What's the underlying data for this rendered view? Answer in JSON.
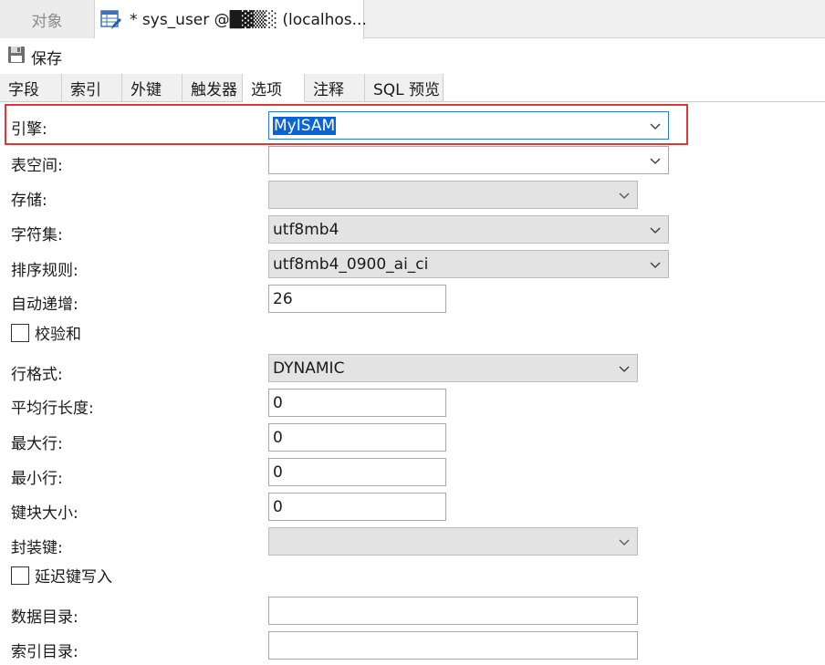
{
  "doc_tabs": {
    "objects_label": "对象",
    "active_label": "* sys_user @█▓▒░ (localhos..."
  },
  "toolbar": {
    "save_label": "保存"
  },
  "sub_tabs": [
    {
      "label": "字段",
      "width": 68
    },
    {
      "label": "索引",
      "width": 66
    },
    {
      "label": "外键",
      "width": 66
    },
    {
      "label": "触发器",
      "width": 66
    },
    {
      "label": "选项",
      "width": 68
    },
    {
      "label": "注释",
      "width": 66
    },
    {
      "label": "SQL 预览",
      "width": 86
    }
  ],
  "options": {
    "engine": {
      "label": "引擎:",
      "value": "MyISAM"
    },
    "tablespace": {
      "label": "表空间:",
      "value": ""
    },
    "storage": {
      "label": "存储:",
      "value": ""
    },
    "charset": {
      "label": "字符集:",
      "value": "utf8mb4"
    },
    "collation": {
      "label": "排序规则:",
      "value": "utf8mb4_0900_ai_ci"
    },
    "auto_increment": {
      "label": "自动递增:",
      "value": "26"
    },
    "checksum": {
      "label": "校验和",
      "checked": false
    },
    "row_format": {
      "label": "行格式:",
      "value": "DYNAMIC"
    },
    "avg_row_length": {
      "label": "平均行长度:",
      "value": "0"
    },
    "max_rows": {
      "label": "最大行:",
      "value": "0"
    },
    "min_rows": {
      "label": "最小行:",
      "value": "0"
    },
    "key_block_size": {
      "label": "键块大小:",
      "value": "0"
    },
    "pack_keys": {
      "label": "封装键:",
      "value": ""
    },
    "delay_key_write": {
      "label": "延迟键写入",
      "checked": false
    },
    "data_directory": {
      "label": "数据目录:",
      "value": ""
    },
    "index_directory": {
      "label": "索引目录:",
      "value": ""
    }
  },
  "colors": {
    "highlight": "#e0373b",
    "selection": "#0b64d6"
  }
}
